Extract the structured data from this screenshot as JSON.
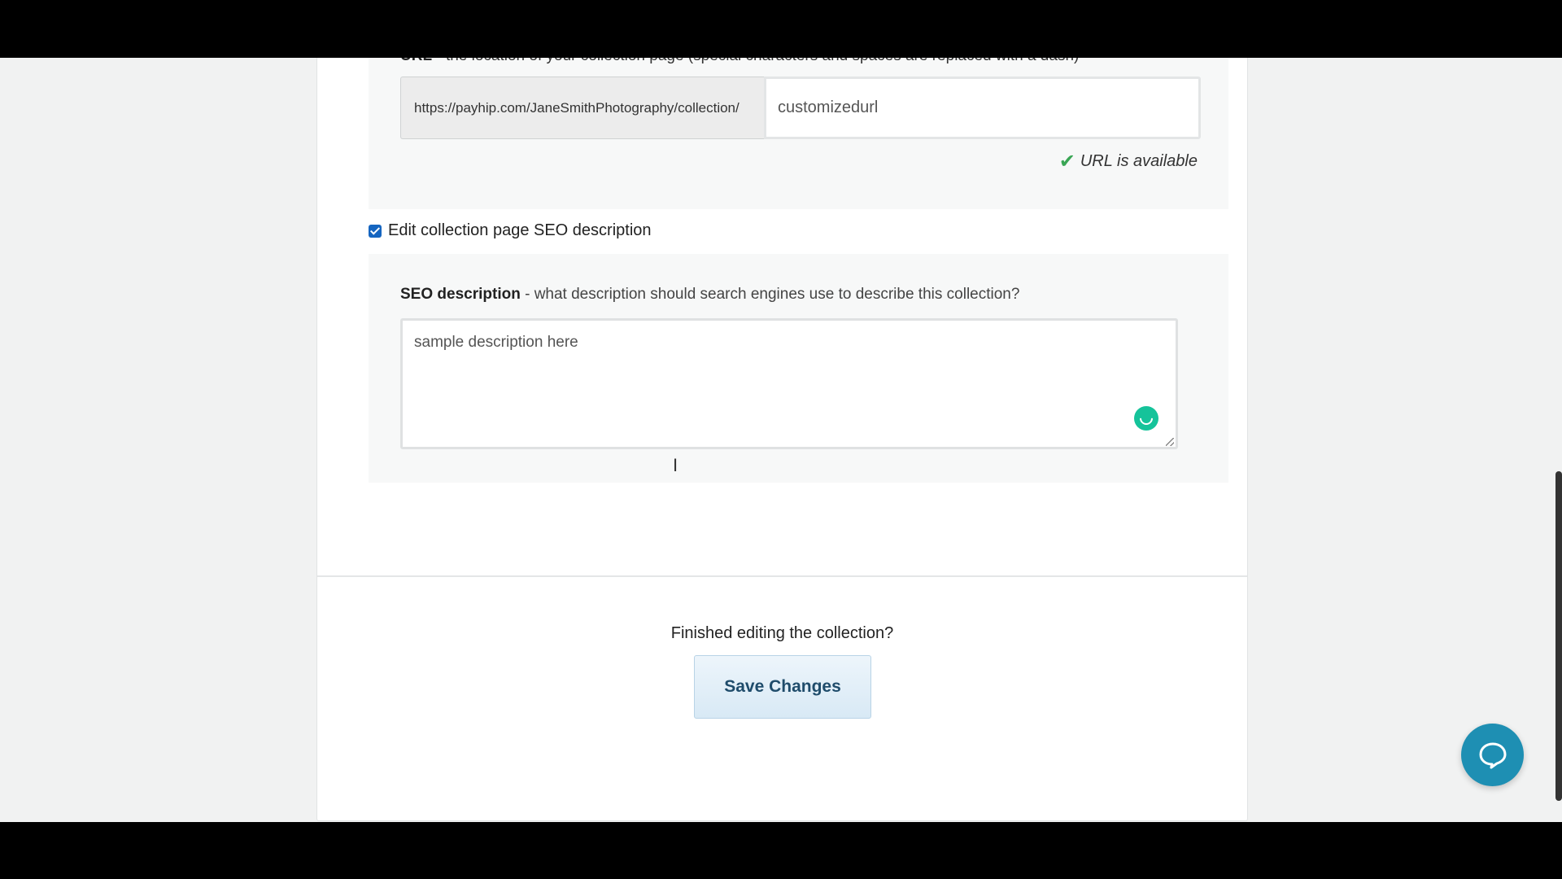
{
  "url_section": {
    "label_bold": "URL",
    "label_rest": " - the location of your collection page (special characters and spaces are replaced with a dash)",
    "prefix": "https://payhip.com/JaneSmithPhotography/collection/",
    "value": "customizedurl",
    "status": "URL is available"
  },
  "seo": {
    "checkbox_label": "Edit collection page SEO description",
    "label_bold": "SEO description",
    "label_rest": " - what description should search engines use to describe this collection?",
    "value": "sample description here"
  },
  "footer": {
    "prompt": "Finished editing the collection?",
    "save_label": "Save Changes"
  },
  "colors": {
    "accent": "#1e8fb3",
    "success": "#3aa655",
    "grammarly": "#15c39a"
  }
}
